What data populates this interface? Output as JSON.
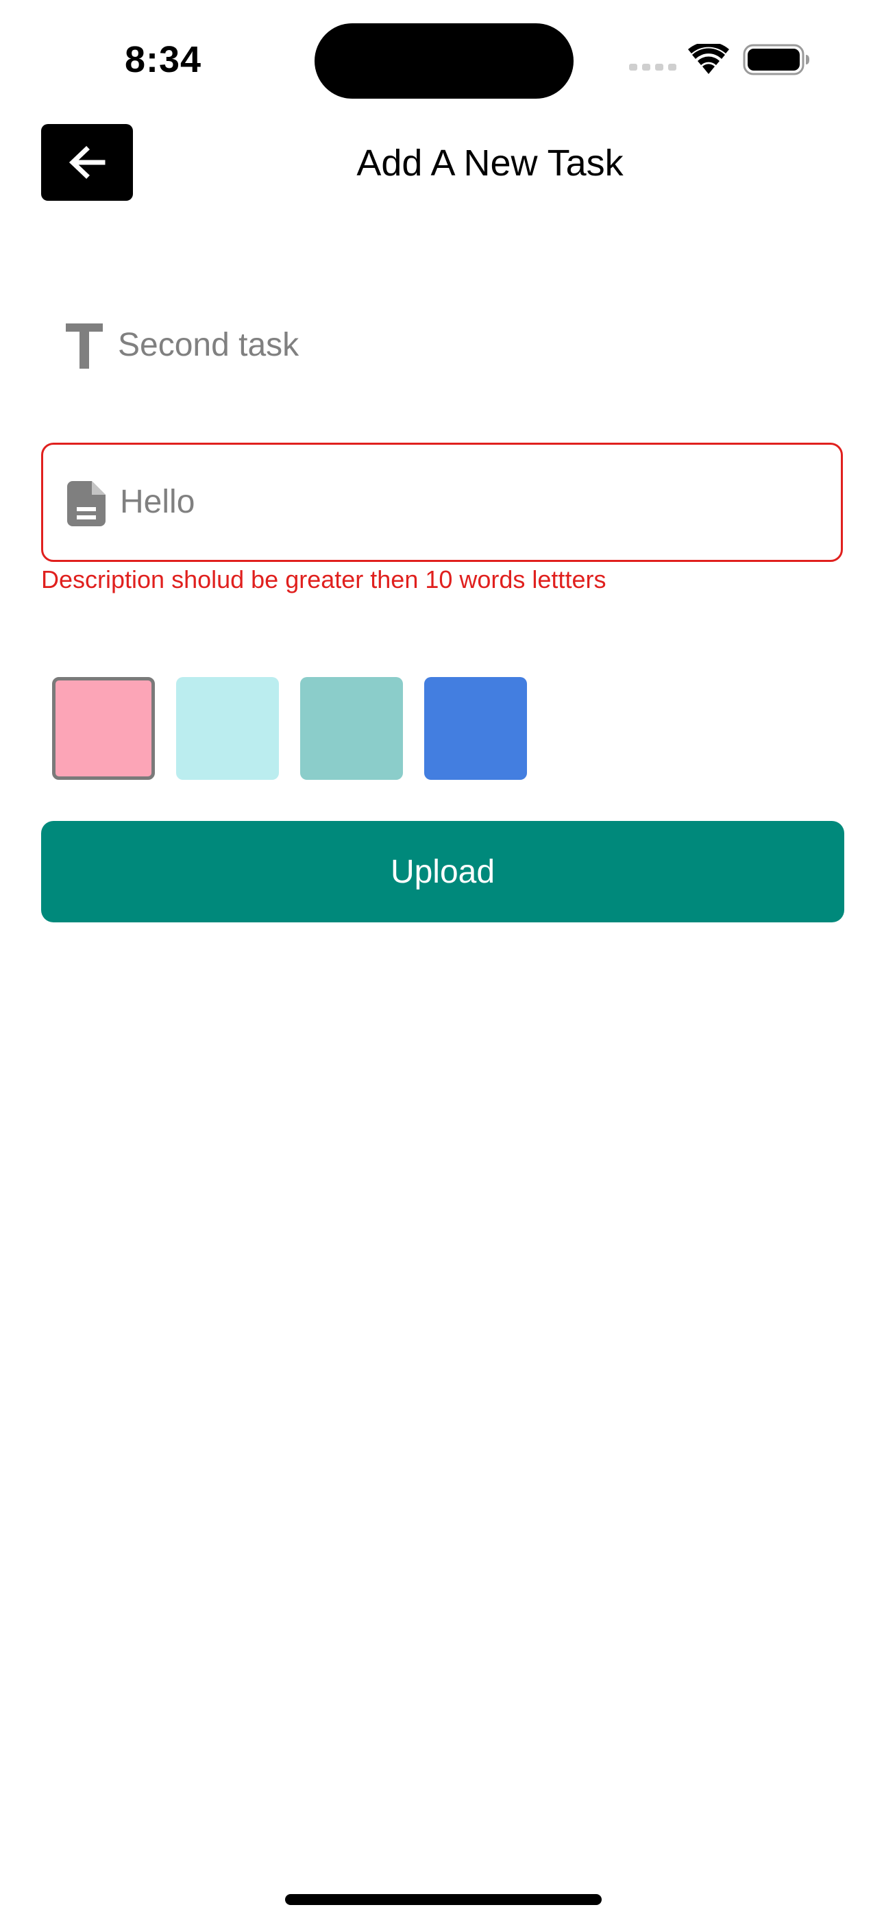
{
  "status_bar": {
    "time": "8:34"
  },
  "header": {
    "title": "Add A New Task",
    "back_icon": "arrow-left-icon"
  },
  "form": {
    "title_field": {
      "icon": "text-format-icon",
      "value": "Second task"
    },
    "description_field": {
      "icon": "document-icon",
      "value": "Hello",
      "error": "Description sholud be greater then 10 words lettters"
    },
    "colors": [
      {
        "hex": "#FCA5B7",
        "selected": true
      },
      {
        "hex": "#BBEDEF",
        "selected": false
      },
      {
        "hex": "#8BCDCA",
        "selected": false
      },
      {
        "hex": "#437EE0",
        "selected": false
      }
    ],
    "upload_label": "Upload",
    "accent_color": "#00897B",
    "error_color": "#E0201E"
  }
}
